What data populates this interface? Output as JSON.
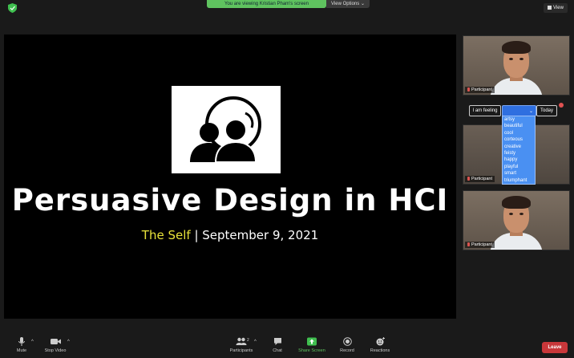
{
  "topbar": {
    "viewing_banner": "You are viewing Kristian Pham's screen",
    "view_options": "View Options ⌄",
    "view_button": "View"
  },
  "slide": {
    "title": "Persuasive Design in HCI",
    "subtitle_highlight": "The Self",
    "subtitle_separator": " | ",
    "subtitle_date": "September 9, 2021"
  },
  "participants": [
    {
      "name": "Participant"
    },
    {
      "name": "Participant"
    },
    {
      "name": "Participant"
    }
  ],
  "feeling_widget": {
    "label": "I am feeling",
    "select_caret": "⌄",
    "suffix": "Today",
    "options": [
      "artsy",
      "beautiful",
      "cool",
      "corteous",
      "creative",
      "feisty",
      "happy",
      "playful",
      "smart",
      "triumphant"
    ]
  },
  "toolbar": {
    "mute": "Mute",
    "stop_video": "Stop Video",
    "participants": "Participants",
    "participants_count": "2",
    "chat": "Chat",
    "share_screen": "Share Screen",
    "record": "Record",
    "reactions": "Reactions",
    "leave": "Leave",
    "caret": "^"
  },
  "colors": {
    "share_green": "#5fc35f",
    "leave_red": "#c9373a",
    "dropdown_blue": "#4a90f2",
    "subtitle_yellow": "#e8e33a"
  }
}
